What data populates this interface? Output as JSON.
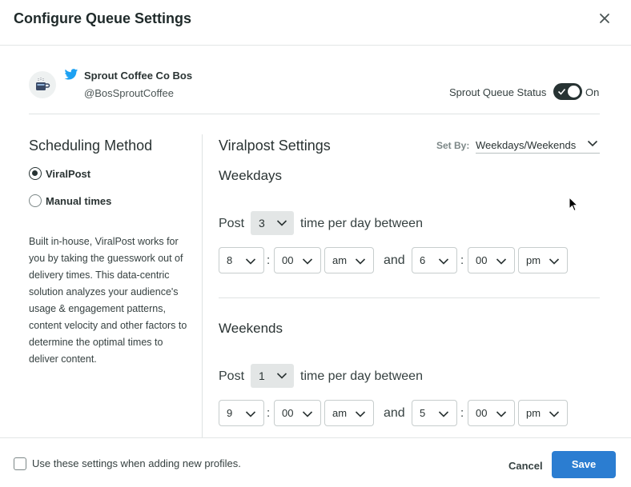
{
  "dialog": {
    "title": "Configure Queue Settings",
    "close_icon": "close-icon"
  },
  "profile": {
    "name": "Sprout Coffee Co Bos",
    "handle": "@BosSproutCoffee",
    "network_icon": "twitter-icon",
    "avatar_icon": "coffee-cup-icon"
  },
  "queue_status": {
    "label": "Sprout Queue Status",
    "state": "On",
    "enabled": true
  },
  "scheduling": {
    "title": "Scheduling Method",
    "options": [
      {
        "label": "ViralPost",
        "checked": true
      },
      {
        "label": "Manual times",
        "checked": false
      }
    ],
    "description": "Built in-house, ViralPost works for you by taking the guesswork out of delivery times. This data-centric solution analyzes your audience's usage & engagement patterns, content velocity and other factors to determine the optimal times to deliver content."
  },
  "viralpost": {
    "title": "Viralpost Settings",
    "set_by_label": "Set By:",
    "set_by_value": "Weekdays/Weekends",
    "post_word": "Post",
    "per_day_text": "time per day between",
    "and_word": "and",
    "weekdays": {
      "title": "Weekdays",
      "count": "3",
      "start": {
        "hour": "8",
        "minute": "00",
        "ampm": "am"
      },
      "end": {
        "hour": "6",
        "minute": "00",
        "ampm": "pm"
      }
    },
    "weekends": {
      "title": "Weekends",
      "count": "1",
      "start": {
        "hour": "9",
        "minute": "00",
        "ampm": "am"
      },
      "end": {
        "hour": "5",
        "minute": "00",
        "ampm": "pm"
      }
    }
  },
  "footer": {
    "checkbox_label": "Use these settings when adding new profiles.",
    "checkbox_checked": false,
    "cancel_label": "Cancel",
    "save_label": "Save"
  },
  "colors": {
    "primary": "#2b7dd1",
    "twitter": "#1da1f2",
    "toggle_on": "#273333"
  }
}
